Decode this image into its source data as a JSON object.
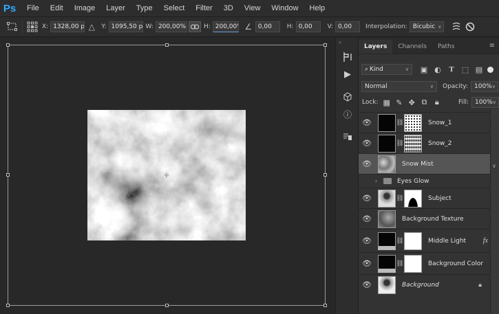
{
  "app": {
    "logo": "Ps"
  },
  "menu": [
    "File",
    "Edit",
    "Image",
    "Layer",
    "Type",
    "Select",
    "Filter",
    "3D",
    "View",
    "Window",
    "Help"
  ],
  "options": {
    "x_label": "X:",
    "x_value": "1328,00 p:",
    "y_label": "Y:",
    "y_value": "1095,50 p:",
    "w_label": "W:",
    "w_value": "200,00%",
    "h_label": "H:",
    "h_value": "200,00%",
    "angle_value": "0,00",
    "hskew_label": "H:",
    "hskew_value": "0,00",
    "vskew_label": "V:",
    "vskew_value": "0,00",
    "interpolation_label": "Interpolation:",
    "interpolation_value": "Bicubic"
  },
  "panel": {
    "tabs": [
      "Layers",
      "Channels",
      "Paths"
    ],
    "filter_kind": "Kind",
    "blend_mode": "Normal",
    "opacity_label": "Opacity:",
    "opacity_value": "100%",
    "lock_label": "Lock:",
    "fill_label": "Fill:",
    "fill_value": "100%"
  },
  "layers": [
    {
      "name": "Snow_1",
      "selected": false
    },
    {
      "name": "Snow_2",
      "selected": false
    },
    {
      "name": "Snow Mist",
      "selected": true
    },
    {
      "name": "Eyes Glow",
      "selected": false
    },
    {
      "name": "Subject",
      "selected": false
    },
    {
      "name": "Background Texture",
      "selected": false
    },
    {
      "name": "Middle Light",
      "selected": false,
      "fx": "fx"
    },
    {
      "name": "Background Color",
      "selected": false
    },
    {
      "name": "Background",
      "selected": false
    }
  ],
  "colors": {
    "brand": "#31a8ff",
    "selected_layer": "#555555",
    "panel_bg": "#333333"
  }
}
